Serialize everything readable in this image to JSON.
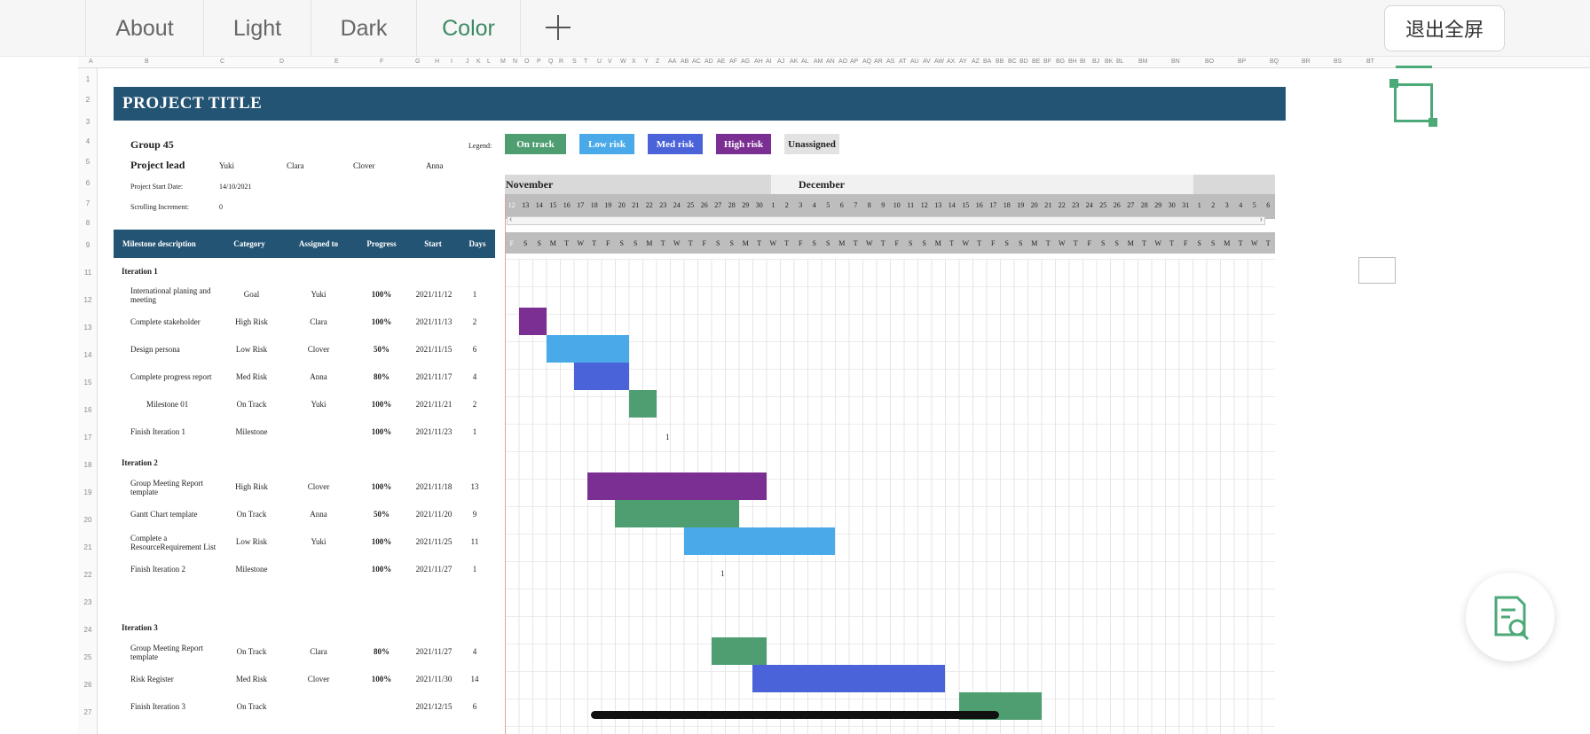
{
  "tabs": [
    "About",
    "Light",
    "Dark",
    "Color"
  ],
  "active_tab": "Color",
  "add_tab_icon": "plus-icon",
  "exit_fullscreen_label": "退出全屏",
  "find_icon": "document-search-icon",
  "colors": {
    "title_bar": "#245474",
    "on_track": "#4e9e72",
    "low_risk": "#4aaae9",
    "med_risk": "#4a63d9",
    "high_risk": "#7b2f93",
    "unassigned": "#e2e2e2",
    "accent": "#4caa78"
  },
  "column_headers": [
    "A",
    "B",
    "C",
    "D",
    "E",
    "F",
    "G",
    "H",
    "I",
    "J",
    "K",
    "L",
    "M",
    "N",
    "O",
    "P",
    "Q",
    "R",
    "S",
    "T",
    "U",
    "V",
    "W",
    "X",
    "Y",
    "Z",
    "AA",
    "AB",
    "AC",
    "AD",
    "AE",
    "AF",
    "AG",
    "AH",
    "AI",
    "AJ",
    "AK",
    "AL",
    "AM",
    "AN",
    "AO",
    "AP",
    "AQ",
    "AR",
    "AS",
    "AT",
    "AU",
    "AV",
    "AW",
    "AX",
    "AY",
    "AZ",
    "BA",
    "BB",
    "BC",
    "BD",
    "BE",
    "BF",
    "BG",
    "BH",
    "BI",
    "BJ",
    "BK",
    "BL",
    "BM",
    "BN",
    "BO",
    "BP",
    "BQ",
    "BR",
    "BS",
    "BT",
    "BU"
  ],
  "row_numbers": [
    "1",
    "2",
    "3",
    "4",
    "5",
    "6",
    "7",
    "8",
    "9",
    "11",
    "12",
    "13",
    "14",
    "15",
    "16",
    "17",
    "18",
    "19",
    "20",
    "21",
    "22",
    "23",
    "24",
    "25",
    "26",
    "27"
  ],
  "project": {
    "title": "PROJECT TITLE",
    "group": "Group 45",
    "lead_label": "Project lead",
    "members": [
      "Yuki",
      "Clara",
      "Clover",
      "Anna"
    ],
    "start_label": "Project Start Date:",
    "start_value": "14/10/2021",
    "increment_label": "Scrolling Increment:",
    "increment_value": "0"
  },
  "legend": {
    "label": "Legend:",
    "items": [
      "On track",
      "Low risk",
      "Med risk",
      "High risk",
      "Unassigned"
    ]
  },
  "table": {
    "headers": [
      "Milestone description",
      "Category",
      "Assigned to",
      "Progress",
      "Start",
      "Days"
    ],
    "iteration1": "Iteration 1",
    "iteration2": "Iteration 2",
    "iteration3": "Iteration 3",
    "rows": [
      {
        "desc": "International planing and meeting",
        "cat": "Goal",
        "who": "Yuki",
        "prog": "100%",
        "start": "2021/11/12",
        "days": "1"
      },
      {
        "desc": "Complete stakeholder",
        "cat": "High Risk",
        "who": "Clara",
        "prog": "100%",
        "start": "2021/11/13",
        "days": "2"
      },
      {
        "desc": "Design persona",
        "cat": "Low Risk",
        "who": "Clover",
        "prog": "50%",
        "start": "2021/11/15",
        "days": "6"
      },
      {
        "desc": "Complete progress report",
        "cat": "Med Risk",
        "who": "Anna",
        "prog": "80%",
        "start": "2021/11/17",
        "days": "4"
      },
      {
        "desc": "Milestone 01",
        "cat": "On Track",
        "who": "Yuki",
        "prog": "100%",
        "start": "2021/11/21",
        "days": "2"
      },
      {
        "desc": "Finish Iteration 1",
        "cat": "Milestone",
        "who": "",
        "prog": "100%",
        "start": "2021/11/23",
        "days": "1"
      },
      {
        "desc": "Group Meeting Report template",
        "cat": "High Risk",
        "who": "Clover",
        "prog": "100%",
        "start": "2021/11/18",
        "days": "13"
      },
      {
        "desc": "Gantt Chart template",
        "cat": "On Track",
        "who": "Anna",
        "prog": "50%",
        "start": "2021/11/20",
        "days": "9"
      },
      {
        "desc": "Complete a ResourceRequirement List",
        "cat": "Low Risk",
        "who": "Yuki",
        "prog": "100%",
        "start": "2021/11/25",
        "days": "11"
      },
      {
        "desc": "Finish Iteration 2",
        "cat": "Milestone",
        "who": "",
        "prog": "100%",
        "start": "2021/11/27",
        "days": "1"
      },
      {
        "desc": "Group Meeting Report template",
        "cat": "On Track",
        "who": "Clara",
        "prog": "80%",
        "start": "2021/11/27",
        "days": "4"
      },
      {
        "desc": "Risk Register",
        "cat": "Med Risk",
        "who": "Clover",
        "prog": "100%",
        "start": "2021/11/30",
        "days": "14"
      },
      {
        "desc": "Finish Iteration 3",
        "cat": "On Track",
        "who": "",
        "prog": "",
        "start": "2021/12/15",
        "days": "6"
      }
    ]
  },
  "gantt": {
    "months": [
      "November",
      "December"
    ],
    "first_date_label": "12",
    "dates": [
      "12",
      "13",
      "14",
      "15",
      "16",
      "17",
      "18",
      "19",
      "20",
      "21",
      "22",
      "23",
      "24",
      "25",
      "26",
      "27",
      "28",
      "29",
      "30",
      "1",
      "2",
      "3",
      "4",
      "5",
      "6",
      "7",
      "8",
      "9",
      "10",
      "11",
      "12",
      "13",
      "14",
      "15",
      "16",
      "17",
      "18",
      "19",
      "20",
      "21",
      "22",
      "23",
      "24",
      "25",
      "26",
      "27",
      "28",
      "29",
      "30",
      "31",
      "1",
      "2",
      "3",
      "4",
      "5",
      "6"
    ],
    "weekdays": [
      "F",
      "S",
      "S",
      "M",
      "T",
      "W",
      "T",
      "F",
      "S",
      "S",
      "M",
      "T",
      "W",
      "T",
      "F",
      "S",
      "S",
      "M",
      "T",
      "W",
      "T",
      "F",
      "S",
      "S",
      "M",
      "T",
      "W",
      "T",
      "F",
      "S",
      "S",
      "M",
      "T",
      "W",
      "T",
      "F",
      "S",
      "S",
      "M",
      "T",
      "W",
      "T",
      "F",
      "S",
      "S",
      "M",
      "T",
      "W",
      "T",
      "F",
      "S",
      "S",
      "M",
      "T",
      "W",
      "T"
    ],
    "milestone_markers": [
      "1",
      "1"
    ]
  }
}
